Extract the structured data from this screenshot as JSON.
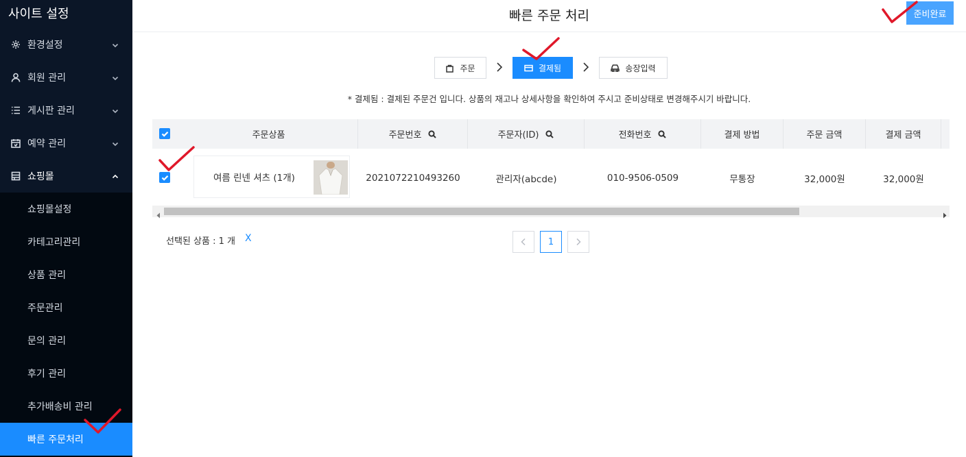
{
  "sidebar": {
    "title": "사이트 설정",
    "items": [
      {
        "label": "환경설정",
        "icon": "gear-icon"
      },
      {
        "label": "회원 관리",
        "icon": "user-icon"
      },
      {
        "label": "게시판 관리",
        "icon": "list-icon"
      },
      {
        "label": "예약 관리",
        "icon": "calendar-icon"
      },
      {
        "label": "쇼핑몰",
        "icon": "store-icon"
      }
    ],
    "sub_items": [
      {
        "label": "쇼핑몰설정"
      },
      {
        "label": "카테고리관리"
      },
      {
        "label": "상품 관리"
      },
      {
        "label": "주문관리"
      },
      {
        "label": "문의 관리"
      },
      {
        "label": "후기 관리"
      },
      {
        "label": "추가배송비 관리"
      },
      {
        "label": "빠른 주문처리"
      }
    ]
  },
  "header": {
    "title": "빠른 주문 처리",
    "ready_button": "준비완료"
  },
  "steps": [
    {
      "label": "주문",
      "icon": "bag-icon"
    },
    {
      "label": "결제됨",
      "icon": "card-icon"
    },
    {
      "label": "송장입력",
      "icon": "truck-icon"
    }
  ],
  "notice": "* 결제됨 : 결제된 주문건 입니다. 상품의 재고나 상세사항을 확인하여 주시고 준비상태로 변경해주시기 바랍니다.",
  "table": {
    "columns": [
      "주문상품",
      "주문번호",
      "주문자(ID)",
      "전화번호",
      "결제 방법",
      "주문 금액",
      "결제 금액"
    ],
    "rows": [
      {
        "product": "여름 린넨 셔츠 (1개)",
        "order_no": "2021072210493260",
        "orderer": "관리자(abcde)",
        "phone": "010-9506-0509",
        "payment_method": "무통장",
        "order_amount": "32,000원",
        "paid_amount": "32,000원"
      }
    ]
  },
  "footer": {
    "selected_text": "선택된 상품 : 1 개",
    "clear_label": "X",
    "current_page": "1"
  },
  "colors": {
    "accent": "#1a8cff",
    "sidebar_bg": "#0b1627",
    "check_mark": "#e0182a"
  }
}
